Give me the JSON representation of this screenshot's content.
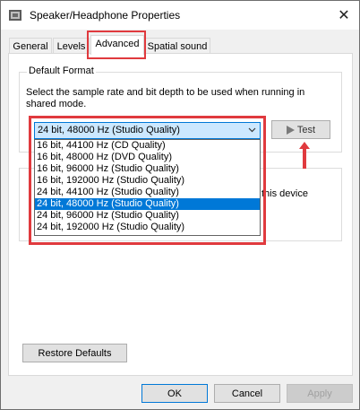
{
  "window": {
    "title": "Speaker/Headphone Properties",
    "close_glyph": "✕"
  },
  "tabs": [
    {
      "label": "General",
      "active": false
    },
    {
      "label": "Levels",
      "active": false
    },
    {
      "label": "Advanced",
      "active": true
    },
    {
      "label": "Spatial sound",
      "active": false
    }
  ],
  "default_format": {
    "title": "Default Format",
    "description": "Select the sample rate and bit depth to be used when running in shared mode.",
    "selected": "24 bit, 48000 Hz (Studio Quality)",
    "options": [
      "16 bit, 44100 Hz (CD Quality)",
      "16 bit, 48000 Hz (DVD Quality)",
      "16 bit, 96000 Hz (Studio Quality)",
      "16 bit, 192000 Hz (Studio Quality)",
      "24 bit, 44100 Hz (Studio Quality)",
      "24 bit, 48000 Hz (Studio Quality)",
      "24 bit, 96000 Hz (Studio Quality)",
      "24 bit, 192000 Hz (Studio Quality)"
    ],
    "selected_index": 5,
    "test_label": "Test"
  },
  "exclusive_mode": {
    "visible_text": "this device"
  },
  "buttons": {
    "restore": "Restore Defaults",
    "ok": "OK",
    "cancel": "Cancel",
    "apply": "Apply"
  },
  "colors": {
    "highlight": "#e03a3e",
    "selection": "#0078d7",
    "accent_light": "#cce8ff"
  },
  "icons": {
    "app": "speaker-icon",
    "test": "play-icon",
    "dropdown": "chevron-down-icon",
    "annotation": "up-arrow-icon"
  }
}
